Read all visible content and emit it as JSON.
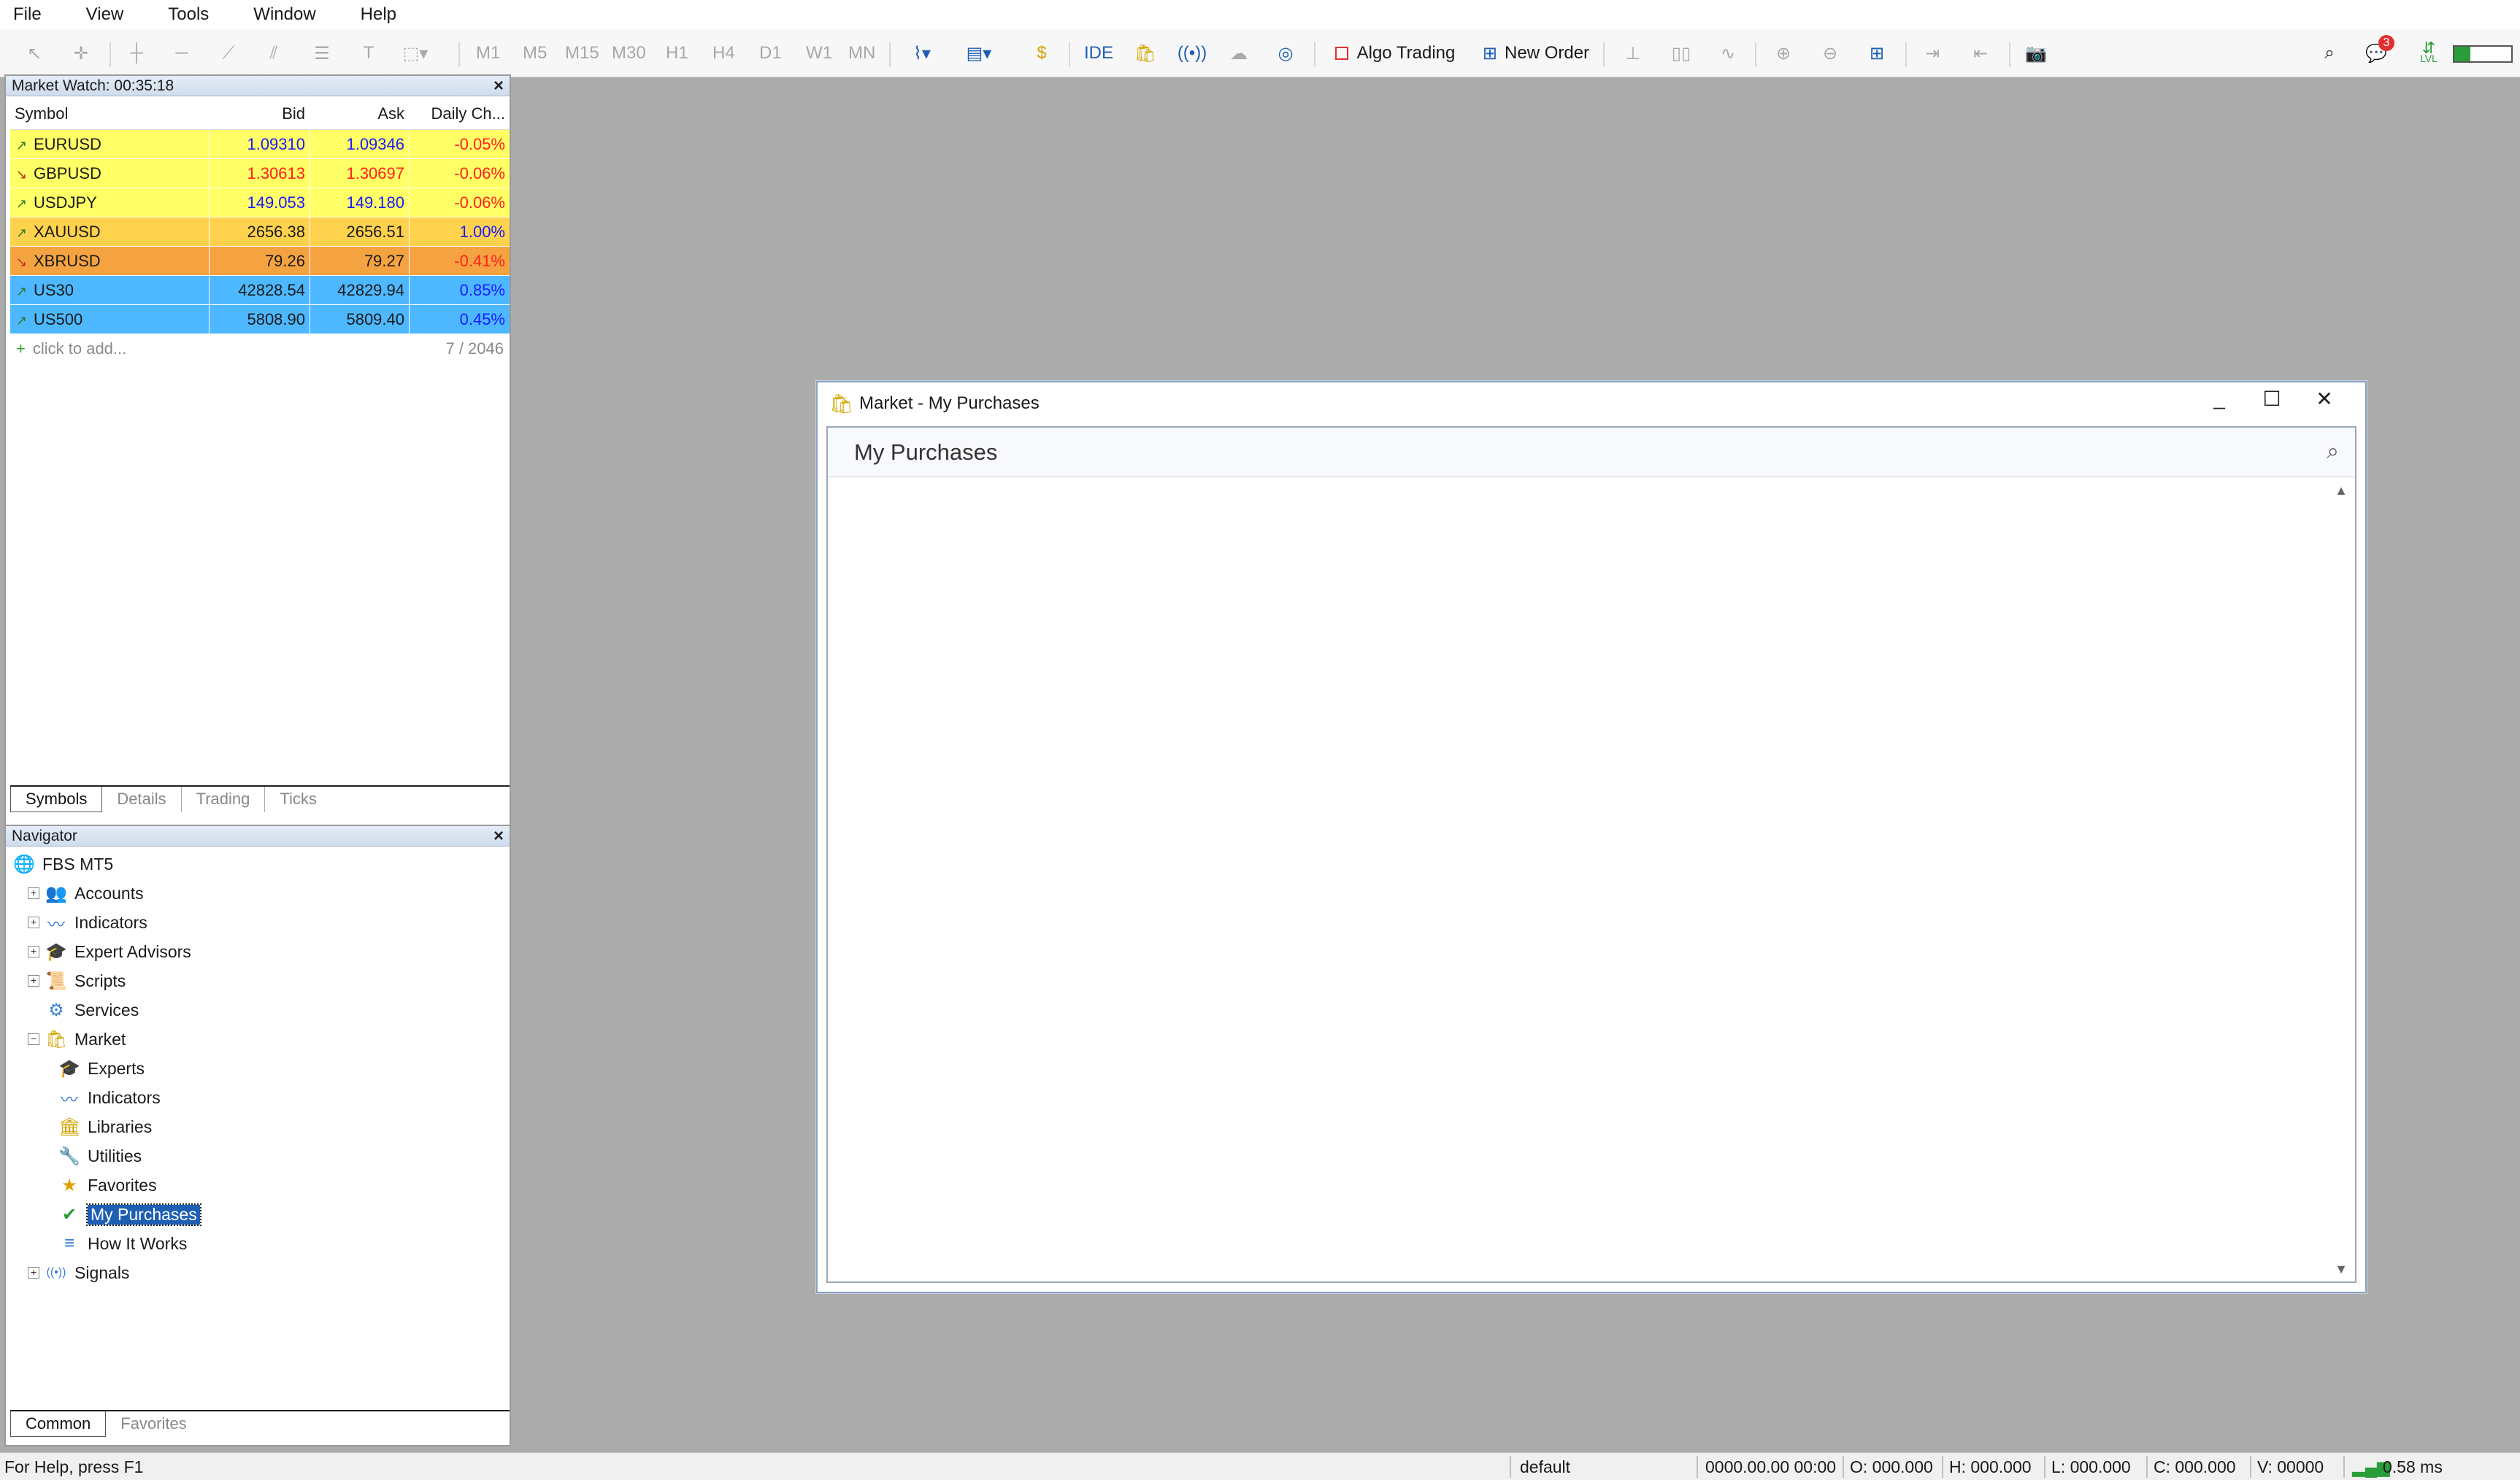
{
  "menu": [
    "File",
    "View",
    "Tools",
    "Window",
    "Help"
  ],
  "toolbar": {
    "timeframes": [
      "M1",
      "M5",
      "M15",
      "M30",
      "H1",
      "H4",
      "D1",
      "W1",
      "MN"
    ],
    "ide_label": "IDE",
    "algo_trading_label": "Algo Trading",
    "new_order_label": "New Order",
    "notification_count": "3",
    "lvl_label": "LVL"
  },
  "market_watch": {
    "title": "Market Watch: 00:35:18",
    "columns": [
      "Symbol",
      "Bid",
      "Ask",
      "Daily Ch..."
    ],
    "rows": [
      {
        "symbol": "EURUSD",
        "bid": "1.09310",
        "ask": "1.09346",
        "change": "-0.05%",
        "direction": "up",
        "bg": "#ffff66",
        "value_color": "#1a1aff",
        "change_color": "#ff2020"
      },
      {
        "symbol": "GBPUSD",
        "bid": "1.30613",
        "ask": "1.30697",
        "change": "-0.06%",
        "direction": "down",
        "bg": "#ffff66",
        "value_color": "#ff2020",
        "change_color": "#ff2020"
      },
      {
        "symbol": "USDJPY",
        "bid": "149.053",
        "ask": "149.180",
        "change": "-0.06%",
        "direction": "up",
        "bg": "#ffff66",
        "value_color": "#1a1aff",
        "change_color": "#ff2020"
      },
      {
        "symbol": "XAUUSD",
        "bid": "2656.38",
        "ask": "2656.51",
        "change": "1.00%",
        "direction": "up",
        "bg": "#ffd24d",
        "value_color": "#1a1a1a",
        "change_color": "#1a1aff"
      },
      {
        "symbol": "XBRUSD",
        "bid": "79.26",
        "ask": "79.27",
        "change": "-0.41%",
        "direction": "down",
        "bg": "#f5a340",
        "value_color": "#1a1a1a",
        "change_color": "#ff2020"
      },
      {
        "symbol": "US30",
        "bid": "42828.54",
        "ask": "42829.94",
        "change": "0.85%",
        "direction": "up",
        "bg": "#4db8ff",
        "value_color": "#1a1a1a",
        "change_color": "#1a1aff"
      },
      {
        "symbol": "US500",
        "bid": "5808.90",
        "ask": "5809.40",
        "change": "0.45%",
        "direction": "up",
        "bg": "#4db8ff",
        "value_color": "#1a1a1a",
        "change_color": "#1a1aff"
      }
    ],
    "add_label": "click to add...",
    "count_label": "7 / 2046",
    "tabs": [
      "Symbols",
      "Details",
      "Trading",
      "Ticks"
    ],
    "active_tab": "Symbols"
  },
  "navigator": {
    "title": "Navigator",
    "items": [
      {
        "label": "FBS MT5",
        "level": 0,
        "icon": "broker-icon",
        "glyph": "🌐",
        "expander": ""
      },
      {
        "label": "Accounts",
        "level": 1,
        "icon": "accounts-icon",
        "glyph": "👥",
        "expander": "+"
      },
      {
        "label": "Indicators",
        "level": 1,
        "icon": "indicators-icon",
        "glyph": "〰",
        "expander": "+"
      },
      {
        "label": "Expert Advisors",
        "level": 1,
        "icon": "expert-advisors-icon",
        "glyph": "🎓",
        "expander": "+"
      },
      {
        "label": "Scripts",
        "level": 1,
        "icon": "scripts-icon",
        "glyph": "📜",
        "expander": "+"
      },
      {
        "label": "Services",
        "level": 1,
        "icon": "services-icon",
        "glyph": "⚙",
        "expander": ""
      },
      {
        "label": "Market",
        "level": 1,
        "icon": "market-icon",
        "glyph": "🛍",
        "expander": "−"
      },
      {
        "label": "Experts",
        "level": 2,
        "icon": "experts-icon",
        "glyph": "🎓",
        "expander": ""
      },
      {
        "label": "Indicators",
        "level": 2,
        "icon": "indicators-icon",
        "glyph": "〰",
        "expander": ""
      },
      {
        "label": "Libraries",
        "level": 2,
        "icon": "libraries-icon",
        "glyph": "🏛",
        "expander": ""
      },
      {
        "label": "Utilities",
        "level": 2,
        "icon": "utilities-icon",
        "glyph": "🔧",
        "expander": ""
      },
      {
        "label": "Favorites",
        "level": 2,
        "icon": "favorites-icon",
        "glyph": "★",
        "expander": ""
      },
      {
        "label": "My Purchases",
        "level": 2,
        "icon": "purchases-icon",
        "glyph": "✔",
        "expander": "",
        "selected": true
      },
      {
        "label": "How It Works",
        "level": 2,
        "icon": "how-it-works-icon",
        "glyph": "≡",
        "expander": ""
      },
      {
        "label": "Signals",
        "level": 1,
        "icon": "signals-icon",
        "glyph": "((•))",
        "expander": "+"
      }
    ],
    "tabs": [
      "Common",
      "Favorites"
    ],
    "active_tab": "Common"
  },
  "dialog": {
    "title": "Market - My Purchases",
    "header": "My Purchases"
  },
  "statusbar": {
    "help": "For Help, press F1",
    "profile": "default",
    "datetime": "0000.00.00 00:00",
    "open": "O: 000.000",
    "high": "H: 000.000",
    "low": "L: 000.000",
    "close": "C: 000.000",
    "volume": "V: 00000",
    "ping": "0.58 ms"
  }
}
